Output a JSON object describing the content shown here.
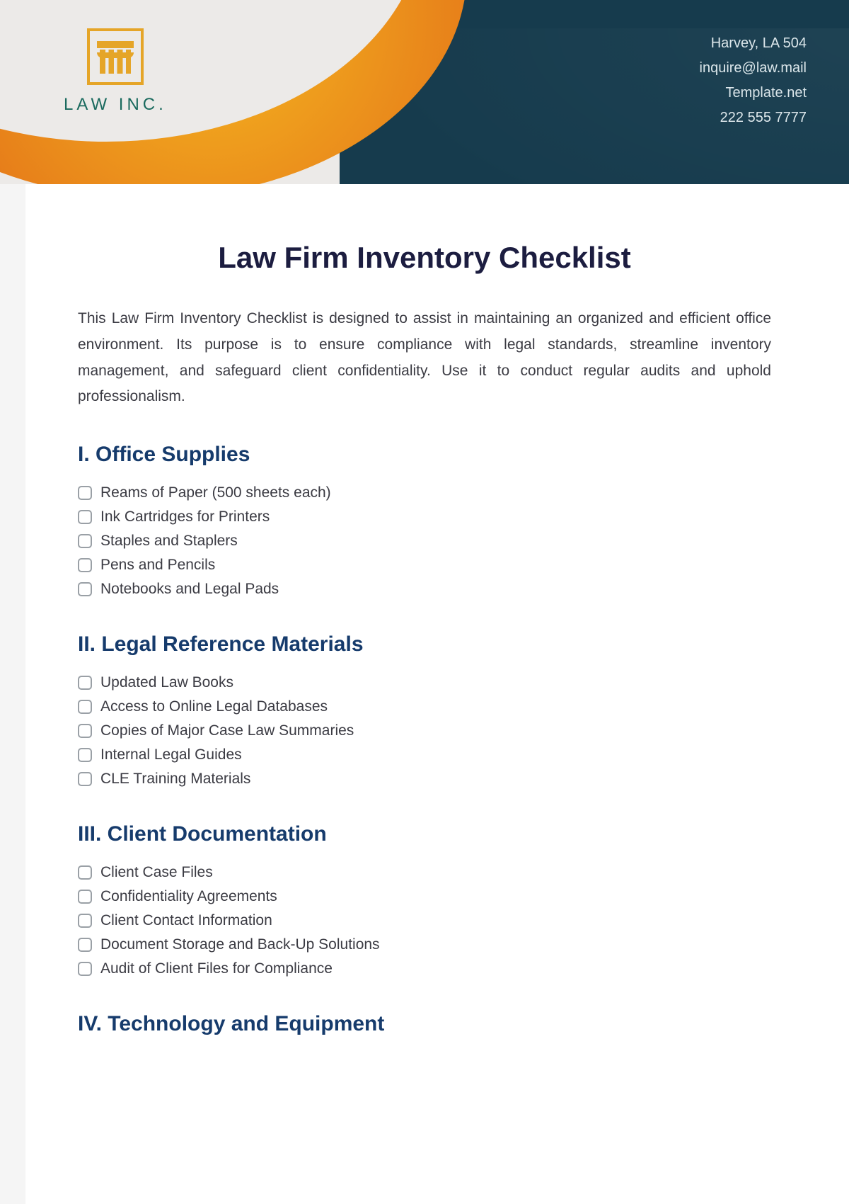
{
  "header": {
    "logo_text": "LAW INC.",
    "contact": {
      "address": "Harvey, LA 504",
      "email": "inquire@law.mail",
      "website": "Template.net",
      "phone": "222 555 7777"
    }
  },
  "title": "Law Firm Inventory Checklist",
  "intro": "This Law Firm Inventory Checklist is designed to assist in maintaining an organized and efficient office environment. Its purpose is to ensure compliance with legal standards, streamline inventory management, and safeguard client confidentiality. Use it to conduct regular audits and uphold professionalism.",
  "sections": [
    {
      "heading": "I. Office Supplies",
      "items": [
        "Reams of Paper (500 sheets each)",
        "Ink Cartridges for Printers",
        "Staples and Staplers",
        "Pens and Pencils",
        "Notebooks and Legal Pads"
      ]
    },
    {
      "heading": "II. Legal Reference Materials",
      "items": [
        "Updated Law Books",
        "Access to Online Legal Databases",
        "Copies of Major Case Law Summaries",
        "Internal Legal Guides",
        "CLE Training Materials"
      ]
    },
    {
      "heading": "III. Client Documentation",
      "items": [
        "Client Case Files",
        "Confidentiality Agreements",
        "Client Contact Information",
        "Document Storage and Back-Up Solutions",
        "Audit of Client Files for Compliance"
      ]
    },
    {
      "heading": "IV. Technology and Equipment",
      "items": []
    }
  ]
}
